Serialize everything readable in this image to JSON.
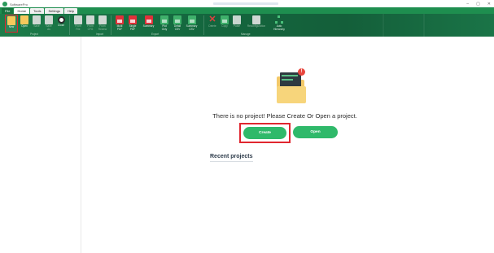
{
  "window": {
    "title": "SoftwarePro",
    "controls": [
      "–",
      "▢",
      "✕"
    ]
  },
  "menu_tabs": [
    {
      "label": "File",
      "state": "file"
    },
    {
      "label": "Home",
      "state": "active"
    },
    {
      "label": "Tools",
      "state": "plain"
    },
    {
      "label": "Settings",
      "state": "plain"
    },
    {
      "label": "Help",
      "state": "plain"
    }
  ],
  "ribbon": {
    "groups": {
      "project": "Project",
      "import": "Import",
      "export": "Export",
      "manage": "Manage"
    },
    "buttons": {
      "new": {
        "label": "New",
        "icon": "new-folder-icon"
      },
      "open": {
        "label": "Open",
        "icon": "open-folder-icon"
      },
      "save": {
        "label": "Save",
        "icon": "save-icon"
      },
      "save_as": {
        "label": "Save\nAs",
        "icon": "save-as-icon"
      },
      "close": {
        "label": "Close",
        "icon": "close-circle-icon"
      },
      "from_file": {
        "label": "From\nFile",
        "icon": "import-file-icon"
      },
      "from_cfg": {
        "label": "From\nCFG",
        "icon": "import-cfg-icon"
      },
      "from_review": {
        "label": "From\nReview",
        "icon": "import-review-icon"
      },
      "multi_pdf": {
        "label": "Multi\nPDF",
        "icon": "pdf-icon"
      },
      "single_pdf": {
        "label": "Single\nPDF",
        "icon": "pdf-icon"
      },
      "summary": {
        "label": "Summary",
        "icon": "pdf-icon"
      },
      "plot_only": {
        "label": "Plot\nOnly",
        "icon": "csv-icon"
      },
      "detail_csv": {
        "label": "Detail\nCSV",
        "icon": "csv-icon"
      },
      "summary_csv": {
        "label": "Summary\nCSV",
        "icon": "csv-icon"
      },
      "delete": {
        "label": "Delete",
        "icon": "delete-icon"
      },
      "copy": {
        "label": "Copy",
        "icon": "copy-icon"
      },
      "paste": {
        "label": "Paste",
        "icon": "paste-icon"
      },
      "reconfiguration": {
        "label": "Reconfiguration",
        "icon": "reconfigure-icon"
      },
      "auto_hierarchy": {
        "label": "Auto\nHierarchy",
        "icon": "hierarchy-icon"
      }
    }
  },
  "main": {
    "empty_message": "There is no project! Please Create Or Open a project.",
    "create_label": "Create",
    "open_label": "Open",
    "recent_title": "Recent projects"
  },
  "colors": {
    "brand_green": "#1e8e4f",
    "button_green": "#2fb96a",
    "highlight_red": "#e0262f",
    "folder_yellow": "#f3c969"
  }
}
